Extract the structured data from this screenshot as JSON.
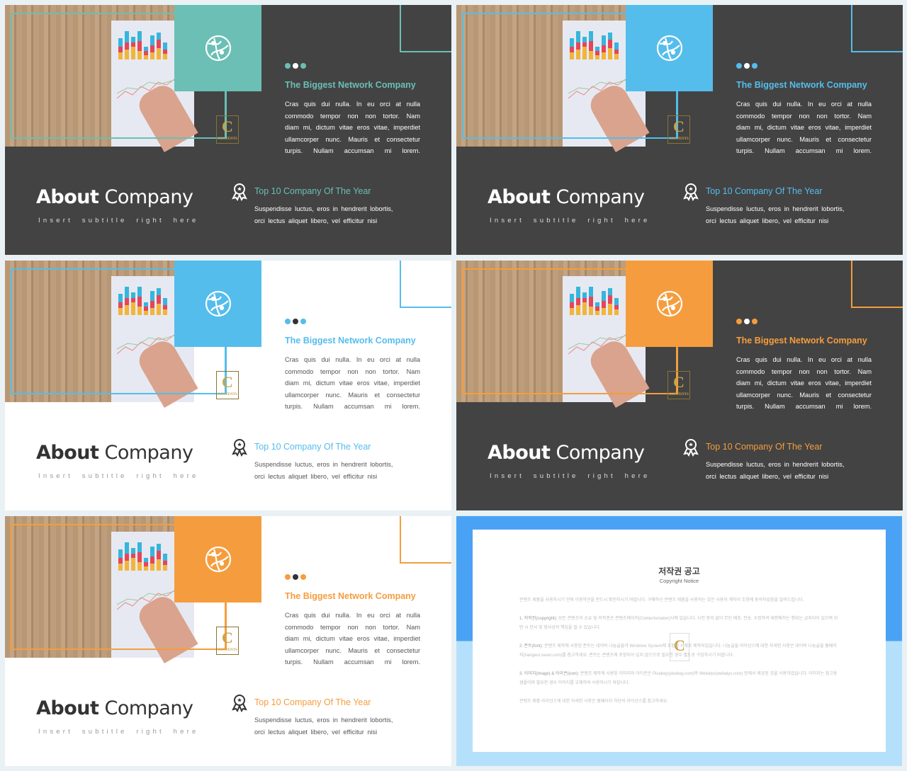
{
  "slides": [
    {
      "theme": "dark",
      "accent": "#6bbfb5",
      "dots": [
        "#6bbfb5",
        "#ffffff",
        "#6bbfb5"
      ]
    },
    {
      "theme": "dark",
      "accent": "#55bdec",
      "dots": [
        "#55bdec",
        "#ffffff",
        "#55bdec"
      ]
    },
    {
      "theme": "light",
      "accent": "#55bdec",
      "dots": [
        "#55bdec",
        "#333333",
        "#55bdec"
      ]
    },
    {
      "theme": "dark",
      "accent": "#f59d3e",
      "dots": [
        "#f59d3e",
        "#ffffff",
        "#f59d3e"
      ]
    },
    {
      "theme": "light",
      "accent": "#f59d3e",
      "dots": [
        "#f59d3e",
        "#333333",
        "#f59d3e"
      ]
    }
  ],
  "content": {
    "heading": "The Biggest Network Company",
    "paragraph": "Cras quis dui nulla. In eu orci at nulla commodo tempor non non tortor. Nam diam mi, dictum vitae eros vitae, imperdiet ullamcorper nunc. Mauris et consectetur turpis. Nullam accumsan mi lorem.",
    "title_bold": "About",
    "title_rest": " Company",
    "subtitle": "Insert subtitle right here",
    "award_title": "Top 10 Company Of The Year",
    "award_text_1": "Suspendisse luctus, eros in hendrerit lobortis,",
    "award_text_2": "orci lectus aliquet libero, vel efficitur nisi",
    "logo_letter": "C",
    "logo_text": "CONTENTS",
    "icons": {
      "square": "globe-network-icon",
      "award": "award-ribbon-icon"
    }
  },
  "copyright": {
    "title": "저작권 공고",
    "subtitle": "Copyright Notice",
    "intro": "콘텐츠 제품을 사용하시기 전에 이용약관을 반드시 확인하시기 바랍니다. 구매하신 콘텐츠 제품을 사용하는 것은 사용자 계약서 조항에 동의하셨음을 알려드립니다.",
    "s1_label": "1. 저작권(copyright):",
    "s1_text": " 모든 콘텐츠의 소유 및 저작권은 콘텐츠메이커(Contentsmaker)사에 있습니다. 사전 동의 없이 무단 배포, 전송, 수정하여 재판매하는 행위는 금지되어 있으며 위반 시 민사 및 형사상의 책임을 질 수 있습니다.",
    "s2_label": "2. 폰트(font):",
    "s2_text": " 콘텐츠 제작에 사용된 폰트는 네이버 나눔글꼴과 Windows System에 포함된 서체로 제작되었습니다. 나눔글꼴 라이선스에 대한 자세한 사항은 네이버 나눔글꼴 홈페이지(hangeul.naver.com)를 참고하세요. 폰트는 콘텐츠에 포함되어 있지 않으므로 필요한 경우 별도로 구입하시기 바랍니다.",
    "s3_label": "3. 이미지(image) & 아이콘(icon):",
    "s3_text": " 콘텐츠 제작에 사용된 이미지와 아이콘은 Pixabay(pixabay.com)와 Webalys(webalys.com) 등에서 제공된 것을 사용하였습니다. 이미지는 참고용 샘플이며 필요한 경우 이미지를 교체하여 사용하시기 바랍니다.",
    "outro": "콘텐츠 제품 라이선스에 대한 자세한 사항은 홈페이지 하단의 라이선스를 참고하세요."
  }
}
